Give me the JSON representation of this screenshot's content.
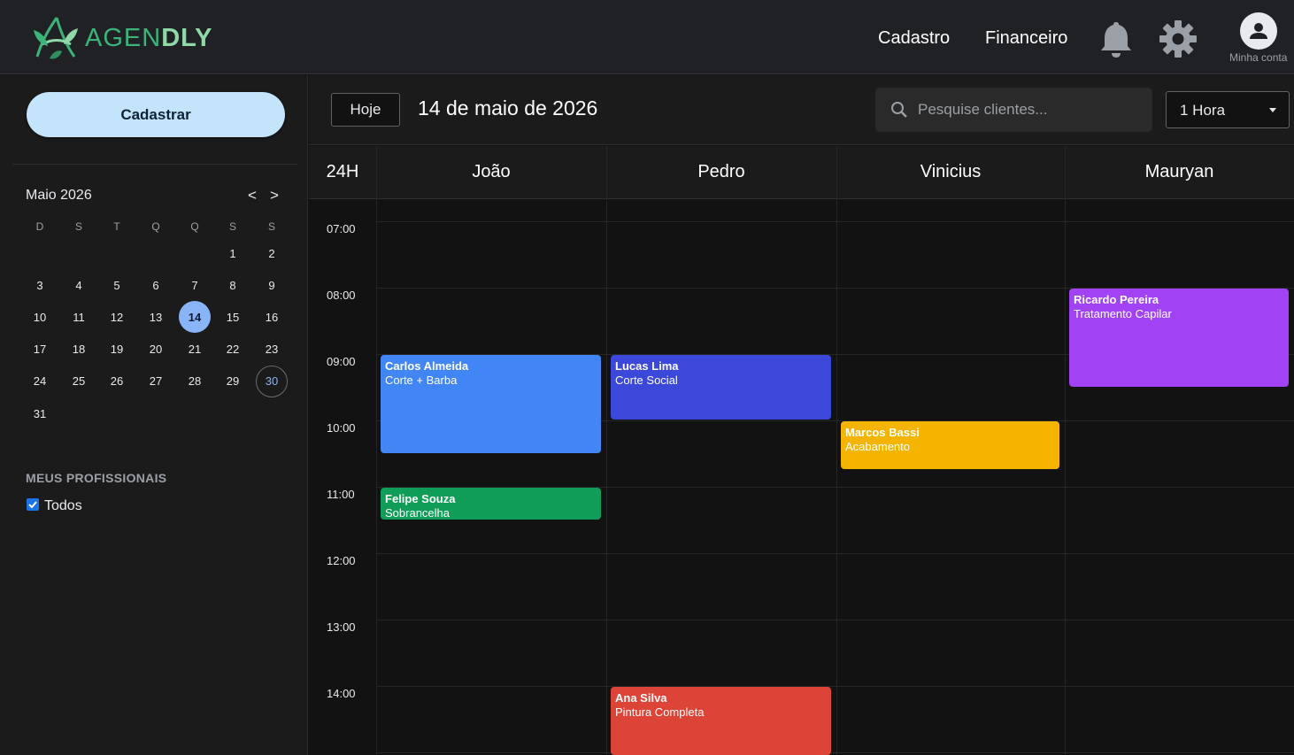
{
  "header": {
    "brand_prefix": "AGEN",
    "brand_suffix": "DLY",
    "nav": [
      "Cadastro",
      "Financeiro"
    ],
    "account_label": "Minha conta"
  },
  "sidebar": {
    "create_label": "Cadastrar",
    "month_title": "Maio 2026",
    "prev": "<",
    "next": ">",
    "weekdays": [
      "D",
      "S",
      "T",
      "Q",
      "Q",
      "S",
      "S"
    ],
    "weeks": [
      [
        "",
        "",
        "",
        "",
        "",
        "1",
        "2"
      ],
      [
        "3",
        "4",
        "5",
        "6",
        "7",
        "8",
        "9"
      ],
      [
        "10",
        "11",
        "12",
        "13",
        "14",
        "15",
        "16"
      ],
      [
        "17",
        "18",
        "19",
        "20",
        "21",
        "22",
        "23"
      ],
      [
        "24",
        "25",
        "26",
        "27",
        "28",
        "29",
        "30"
      ],
      [
        "31",
        "",
        "",
        "",
        "",
        "",
        ""
      ]
    ],
    "selected_day": "14",
    "outlined_day": "30",
    "professionals_title": "MEUS PROFISSIONAIS",
    "all_label": "Todos",
    "all_checked": true
  },
  "toolbar": {
    "today_label": "Hoje",
    "date_title": "14 de maio de 2026",
    "search_placeholder": "Pesquise clientes...",
    "interval_value": "1 Hora"
  },
  "grid": {
    "corner_label": "24H",
    "columns": [
      "João",
      "Pedro",
      "Vinicius",
      "Mauryan"
    ],
    "times": [
      "07:00",
      "08:00",
      "09:00",
      "10:00",
      "11:00",
      "12:00",
      "13:00",
      "14:00"
    ]
  },
  "events": [
    {
      "column": "João",
      "start": "09:00",
      "end": "10:30",
      "client": "Carlos Almeida",
      "service": "Corte + Barba",
      "color": "#4285f4"
    },
    {
      "column": "João",
      "start": "11:00",
      "end": "11:30",
      "client": "Felipe Souza",
      "service": "Sobrancelha",
      "color": "#0f9d58"
    },
    {
      "column": "Pedro",
      "start": "09:00",
      "end": "10:00",
      "client": "Lucas Lima",
      "service": "Corte Social",
      "color": "#3b48d9"
    },
    {
      "column": "Pedro",
      "start": "14:00",
      "end": "15:30",
      "client": "Ana Silva",
      "service": "Pintura Completa",
      "color": "#db4437"
    },
    {
      "column": "Vinicius",
      "start": "10:00",
      "end": "10:45",
      "client": "Marcos Bassi",
      "service": "Acabamento",
      "color": "#f4b400"
    },
    {
      "column": "Mauryan",
      "start": "08:00",
      "end": "09:30",
      "client": "Ricardo Pereira",
      "service": "Tratamento Capilar",
      "color": "#a142f4"
    }
  ]
}
